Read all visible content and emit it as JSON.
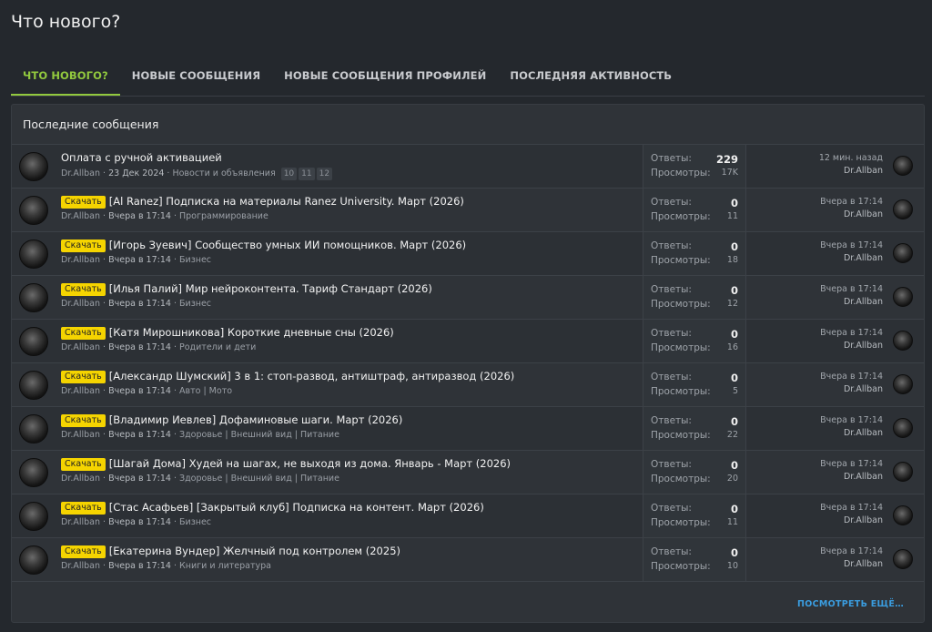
{
  "page": {
    "title": "Что нового?"
  },
  "tabs": [
    {
      "label": "ЧТО НОВОГО?",
      "active": true
    },
    {
      "label": "НОВЫЕ СООБЩЕНИЯ",
      "active": false
    },
    {
      "label": "НОВЫЕ СООБЩЕНИЯ ПРОФИЛЕЙ",
      "active": false
    },
    {
      "label": "ПОСЛЕДНЯЯ АКТИВНОСТЬ",
      "active": false
    }
  ],
  "block": {
    "header": "Последние сообщения",
    "more_link": "ПОСМОТРЕТЬ ЕЩЁ…"
  },
  "labels": {
    "replies": "Ответы:",
    "views": "Просмотры:"
  },
  "threads": [
    {
      "prefix": "",
      "title": "Оплата с ручной активацией",
      "author": "Dr.Allban",
      "date": "23 Дек 2024",
      "forum": "Новости и объявления",
      "pages": [
        "10",
        "11",
        "12"
      ],
      "replies": "229",
      "views": "17K",
      "last_time": "12 мин. назад",
      "last_user": "Dr.Allban"
    },
    {
      "prefix": "Скачать",
      "title": "[Al Ranez] Подписка на материалы Ranez University. Март (2026)",
      "author": "Dr.Allban",
      "date": "Вчера в 17:14",
      "forum": "Программирование",
      "pages": [],
      "replies": "0",
      "views": "11",
      "last_time": "Вчера в 17:14",
      "last_user": "Dr.Allban"
    },
    {
      "prefix": "Скачать",
      "title": "[Игорь Зуевич] Сообщество умных ИИ помощников. Март (2026)",
      "author": "Dr.Allban",
      "date": "Вчера в 17:14",
      "forum": "Бизнес",
      "pages": [],
      "replies": "0",
      "views": "18",
      "last_time": "Вчера в 17:14",
      "last_user": "Dr.Allban"
    },
    {
      "prefix": "Скачать",
      "title": "[Илья Палий] Мир нейроконтента. Тариф Стандарт (2026)",
      "author": "Dr.Allban",
      "date": "Вчера в 17:14",
      "forum": "Бизнес",
      "pages": [],
      "replies": "0",
      "views": "12",
      "last_time": "Вчера в 17:14",
      "last_user": "Dr.Allban"
    },
    {
      "prefix": "Скачать",
      "title": "[Катя Мирошникова] Короткие дневные сны (2026)",
      "author": "Dr.Allban",
      "date": "Вчера в 17:14",
      "forum": "Родители и дети",
      "pages": [],
      "replies": "0",
      "views": "16",
      "last_time": "Вчера в 17:14",
      "last_user": "Dr.Allban"
    },
    {
      "prefix": "Скачать",
      "title": "[Александр Шумский] 3 в 1: стоп-развод, антиштраф, антиразвод (2026)",
      "author": "Dr.Allban",
      "date": "Вчера в 17:14",
      "forum": "Авто | Мото",
      "pages": [],
      "replies": "0",
      "views": "5",
      "last_time": "Вчера в 17:14",
      "last_user": "Dr.Allban"
    },
    {
      "prefix": "Скачать",
      "title": "[Владимир Иевлев] Дофаминовые шаги. Март (2026)",
      "author": "Dr.Allban",
      "date": "Вчера в 17:14",
      "forum": "Здоровье | Внешний вид | Питание",
      "pages": [],
      "replies": "0",
      "views": "22",
      "last_time": "Вчера в 17:14",
      "last_user": "Dr.Allban"
    },
    {
      "prefix": "Скачать",
      "title": "[Шагай Дома] Худей на шагах, не выходя из дома. Январь - Март (2026)",
      "author": "Dr.Allban",
      "date": "Вчера в 17:14",
      "forum": "Здоровье | Внешний вид | Питание",
      "pages": [],
      "replies": "0",
      "views": "20",
      "last_time": "Вчера в 17:14",
      "last_user": "Dr.Allban"
    },
    {
      "prefix": "Скачать",
      "title": "[Стас Асафьев] [Закрытый клуб] Подписка на контент. Март (2026)",
      "author": "Dr.Allban",
      "date": "Вчера в 17:14",
      "forum": "Бизнес",
      "pages": [],
      "replies": "0",
      "views": "11",
      "last_time": "Вчера в 17:14",
      "last_user": "Dr.Allban"
    },
    {
      "prefix": "Скачать",
      "title": "[Екатерина Вундер] Желчный под контролем (2025)",
      "author": "Dr.Allban",
      "date": "Вчера в 17:14",
      "forum": "Книги и литература",
      "pages": [],
      "replies": "0",
      "views": "10",
      "last_time": "Вчера в 17:14",
      "last_user": "Dr.Allban"
    }
  ],
  "colors": {
    "accent": "#92c93e",
    "prefix_bg": "#f5d400",
    "link": "#3a9de0"
  }
}
